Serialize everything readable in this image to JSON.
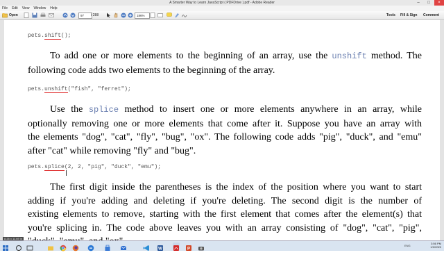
{
  "window": {
    "title": "A Smarter Way to Learn JavaScript ( PDFDrive ).pdf - Adobe Reader"
  },
  "menu": [
    "File",
    "Edit",
    "View",
    "Window",
    "Help"
  ],
  "toolbar": {
    "open_label": "Open",
    "page_current": "97",
    "page_total": "/ 288",
    "zoom": "186%",
    "tools_label": "Tools",
    "fill_sign_label": "Fill & Sign",
    "comment_label": "Comment"
  },
  "document": {
    "code1": {
      "prefix": "pets.",
      "method": "shift",
      "args": "();"
    },
    "para1": {
      "l1_a": "To add one or more elements to the beginning of an array, use the ",
      "l1_code": "unshift",
      "l1_b": " method. The",
      "l2": "following code adds two elements to the beginning of the array."
    },
    "code2": {
      "prefix": "pets.",
      "method": "unshift",
      "args": "(\"fish\", \"ferret\");"
    },
    "para2": {
      "l1_a": "Use the ",
      "l1_code": "splice",
      "l1_b": " method to insert one or more elements anywhere in an array, while",
      "l2": "optionally removing one or more elements that come after it. Suppose you have an array with",
      "l3": "the elements \"dog\", \"cat\", \"fly\", \"bug\", \"ox\". The following code adds \"pig\", \"duck\", and \"emu\"",
      "l4": "after \"cat\" while removing \"fly\" and \"bug\"."
    },
    "code3": {
      "prefix": "pets.",
      "method": "splice",
      "args": "(2, 2, \"pig\", \"duck\", \"emu\");"
    },
    "para3": {
      "l1": "The first digit inside the parentheses is the index of the position where you want to start",
      "l2": "adding if you're adding and deleting if you're deleting. The second digit is the number of",
      "l3": "existing elements to remove, starting with the first element that comes after the element(s) that",
      "l4": "you're splicing in. The code above leaves you with an array consisting of \"dog\", \"cat\", \"pig\",",
      "l5": "\"duck\", \"emu\", and \"ox\"."
    }
  },
  "status_tip": "8.26 x 11.69 in",
  "clock": {
    "time": "3:56 PM",
    "date": "1/2/2020"
  },
  "tray_lang": "ENG",
  "taskbar_icons": [
    "start-icon",
    "search-icon",
    "task-view-icon",
    "file-explorer-icon",
    "chrome-icon",
    "firefox-icon",
    "edge-icon",
    "store-icon",
    "mail-icon",
    "vscode-icon",
    "word-icon",
    "acrobat-icon",
    "powerpoint-icon",
    "camera-icon"
  ]
}
